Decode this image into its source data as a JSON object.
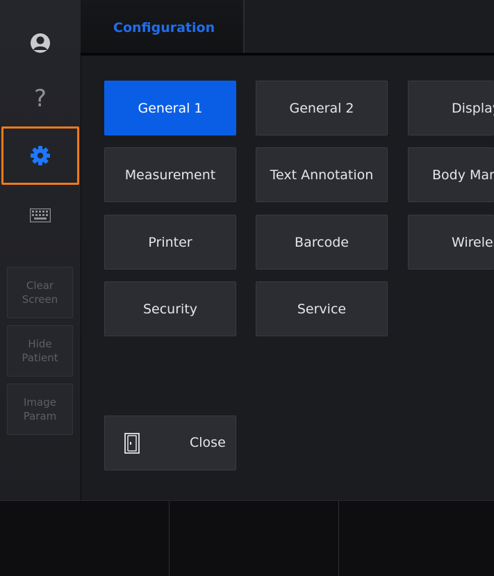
{
  "header": {
    "active_tab": "Configuration"
  },
  "sidebar": {
    "icons": [
      {
        "name": "user-icon"
      },
      {
        "name": "help-icon",
        "glyph": "?"
      },
      {
        "name": "gear-icon",
        "selected": true
      },
      {
        "name": "keyboard-icon"
      }
    ],
    "buttons": [
      {
        "label": "Clear\nScreen"
      },
      {
        "label": "Hide\nPatient"
      },
      {
        "label": "Image\nParam"
      }
    ]
  },
  "config": {
    "buttons": [
      {
        "label": "General 1",
        "active": true
      },
      {
        "label": "General 2"
      },
      {
        "label": "Display"
      },
      {
        "label": "Measurement"
      },
      {
        "label": "Text Annotation"
      },
      {
        "label": "Body Marker"
      },
      {
        "label": "Printer"
      },
      {
        "label": "Barcode"
      },
      {
        "label": "Wireless"
      },
      {
        "label": "Security"
      },
      {
        "label": "Service"
      }
    ],
    "close_label": "Close"
  },
  "colors": {
    "accent": "#0a5ee6",
    "tab_text": "#1e6ef0",
    "selection_outline": "#f07a18",
    "button_bg": "#2c2d33"
  }
}
